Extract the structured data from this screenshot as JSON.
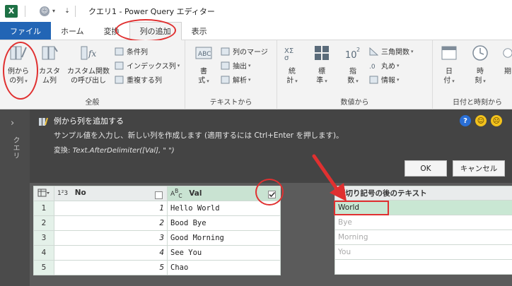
{
  "window": {
    "title": "クエリ1 - Power Query エディター",
    "app_logo": "X"
  },
  "tabs": [
    {
      "label": "ファイル"
    },
    {
      "label": "ホーム"
    },
    {
      "label": "変換"
    },
    {
      "label": "列の追加"
    },
    {
      "label": "表示"
    }
  ],
  "ribbon": {
    "general": {
      "label": "全般",
      "column_from_example": "例から\nの列",
      "column_from_example_l1": "例から",
      "column_from_example_l2": "の列",
      "custom_column_l1": "カスタ",
      "custom_column_l2": "ム列",
      "invoke_custom_l1": "カスタム関数",
      "invoke_custom_l2": "の呼び出し",
      "conditional_column": "条件列",
      "index_column": "インデックス列",
      "duplicate_column": "重複する列"
    },
    "text": {
      "label": "テキストから",
      "format_l1": "書",
      "format_l2": "式",
      "merge_columns": "列のマージ",
      "extract": "抽出",
      "parse": "解析"
    },
    "number": {
      "label": "数値から",
      "statistics_l1": "統",
      "statistics_l2": "計",
      "standard_l1": "標",
      "standard_l2": "準",
      "scientific_l1": "指",
      "scientific_l2": "数",
      "trigonometry": "三角関数",
      "rounding": "丸め",
      "information": "情報"
    },
    "datetime": {
      "label": "日付と時刻から",
      "date_l1": "日",
      "date_l2": "付",
      "time_l1": "時",
      "time_l2": "刻",
      "duration_l1": "期"
    }
  },
  "query_pane": {
    "label": "クエリ"
  },
  "example_panel": {
    "title": "例から列を追加する",
    "description": "サンプル値を入力し、新しい列を作成します (適用するには Ctrl+Enter を押します)。",
    "transform_label": "変換:",
    "transform_value": "Text.AfterDelimiter([Val], \" \")",
    "ok": "OK",
    "cancel": "キャンセル"
  },
  "grid": {
    "columns": [
      {
        "type_icon": "1²3",
        "name": "No"
      },
      {
        "type_icon": "A^B_C",
        "name": "Val"
      }
    ],
    "rows": [
      {
        "num": "1",
        "no": "1",
        "val": "Hello World"
      },
      {
        "num": "2",
        "no": "2",
        "val": "Bood Bye"
      },
      {
        "num": "3",
        "no": "3",
        "val": "Good Morning"
      },
      {
        "num": "4",
        "no": "4",
        "val": "See You"
      },
      {
        "num": "5",
        "no": "5",
        "val": "Chao"
      }
    ]
  },
  "new_column": {
    "header": "区切り記号の後のテキスト",
    "values": [
      "World",
      "Bye",
      "Morning",
      "You",
      ""
    ]
  }
}
